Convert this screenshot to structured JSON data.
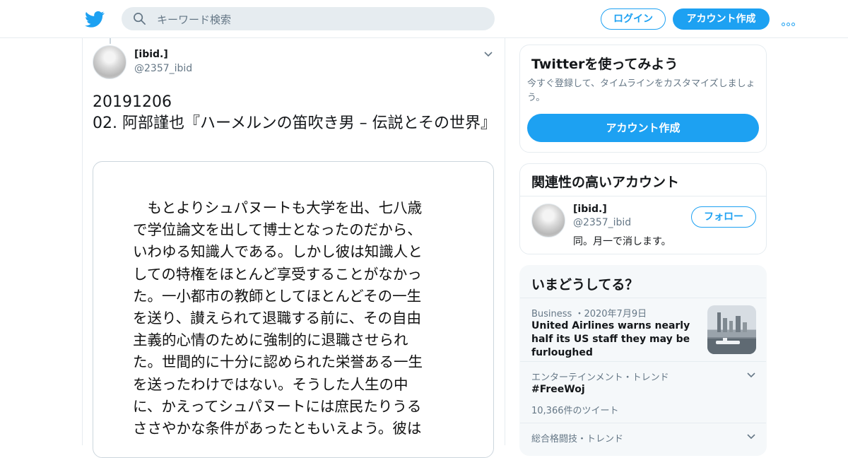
{
  "header": {
    "search_placeholder": "キーワード検索",
    "login_label": "ログイン",
    "create_account_label": "アカウント作成"
  },
  "tweet": {
    "name": "[ibid.]",
    "handle": "@2357_ibid",
    "text": "20191206\n02. 阿部謹也『ハーメルンの笛吹き男 – 伝説とその世界』",
    "image_text_lines": [
      "　もとよりシュパヌートも大学を出、七八歳",
      "で学位論文を出して博士となったのだから、",
      "いわゆる知識人である。しかし彼は知識人と",
      "しての特権をほとんど享受することがなかっ",
      "た。一小都市の教師としてほとんどその一生",
      "を送り、讃えられて退職する前に、その自由",
      "主義的心情のために強制的に退職させられ",
      "た。世間的に十分に認められた栄誉ある一生",
      "を送ったわけではない。そうした人生の中",
      "に、かえってシュパヌートには庶民たりうる",
      "ささやかな条件があったともいえよう。彼は"
    ]
  },
  "signup_card": {
    "title": "Twitterを使ってみよう",
    "description": "今すぐ登録して、タイムラインをカスタマイズしましょう。",
    "button_label": "アカウント作成"
  },
  "related_card": {
    "title": "関連性の高いアカウント",
    "name": "[ibid.]",
    "handle": "@2357_ibid",
    "bio": "同。月一で消します。",
    "follow_label": "フォロー"
  },
  "trends_card": {
    "title": "いまどうしてる？",
    "items": [
      {
        "meta": "Business ・2020年7月9日",
        "title": "United Airlines warns nearly half its US staff they may be furloughed"
      },
      {
        "meta": "エンターテインメント・トレンド",
        "title": "#FreeWoj",
        "count": "10,366件のツイート"
      },
      {
        "meta": "総合格闘技・トレンド"
      }
    ]
  },
  "colors": {
    "accent": "#1da1f2",
    "text": "#14171a",
    "secondary": "#657786",
    "border": "#e6ecf0"
  }
}
